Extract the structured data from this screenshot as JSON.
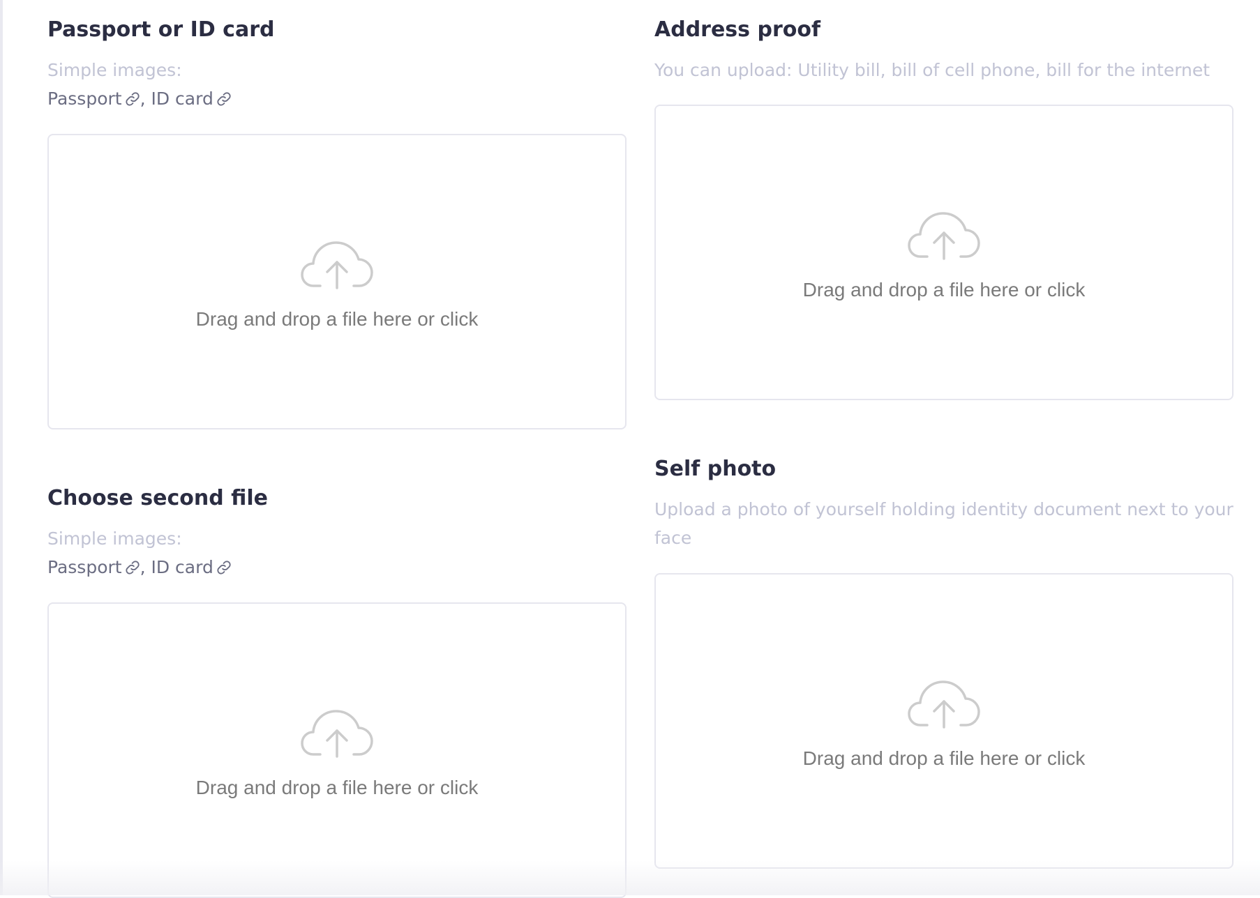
{
  "sections": {
    "passport": {
      "title": "Passport or ID card",
      "hint": "Simple images:",
      "links": [
        "Passport",
        "ID card"
      ],
      "link_separator": ",",
      "dropzone_text": "Drag and drop a file here or click"
    },
    "address": {
      "title": "Address proof",
      "hint": "You can upload: Utility bill, bill of cell phone, bill for the internet",
      "dropzone_text": "Drag and drop a file here or click"
    },
    "second": {
      "title": "Choose second file",
      "hint": "Simple images:",
      "links": [
        "Passport",
        "ID card"
      ],
      "link_separator": ",",
      "dropzone_text": "Drag and drop a file here or click"
    },
    "selfie": {
      "title": "Self photo",
      "hint": "Upload a photo of yourself holding identity document next to your face",
      "dropzone_text": "Drag and drop a file here or click"
    }
  },
  "icons": {
    "upload": "cloud-upload-icon",
    "link": "link-icon"
  },
  "colors": {
    "title": "#2b2d42",
    "hint": "#c1c3d4",
    "link": "#6b6d82",
    "dropzone_border": "#e6e6ee",
    "dropzone_text": "#7a7a7a",
    "icon": "#cccccc"
  }
}
